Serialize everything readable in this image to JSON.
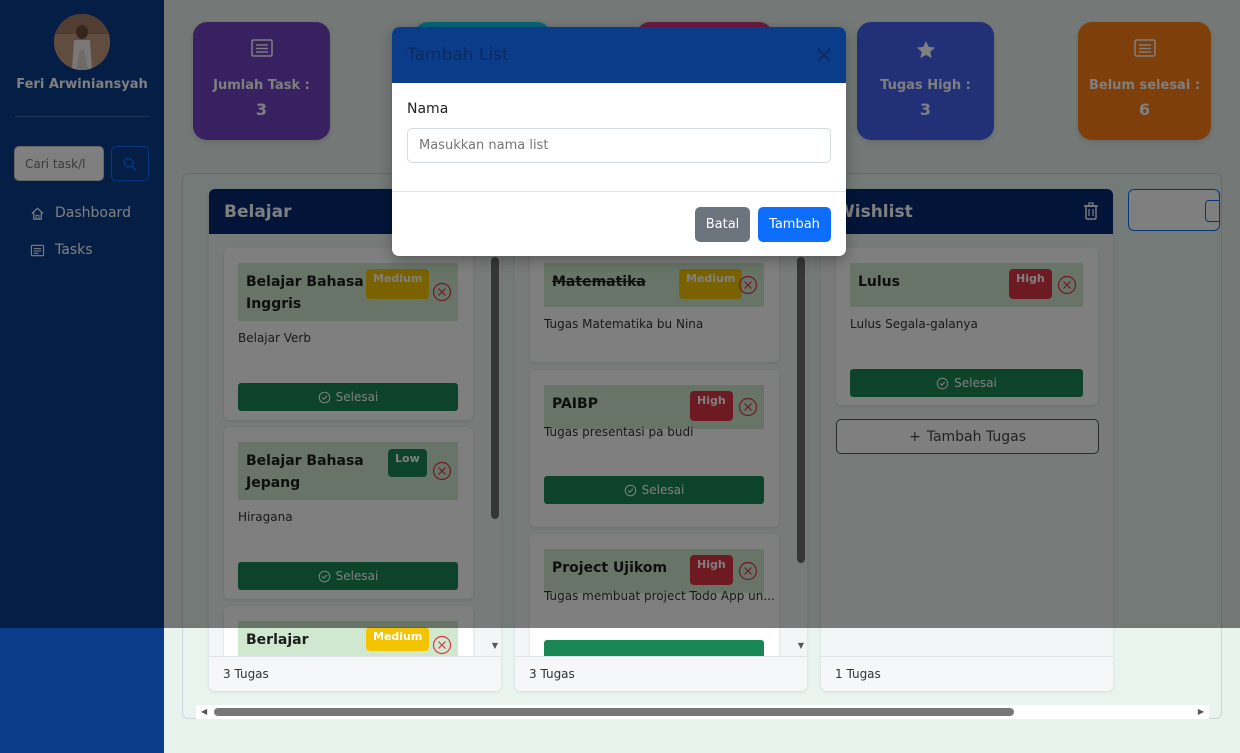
{
  "sidebar": {
    "username": "Feri Arwiniansyah",
    "search_placeholder": "Cari task/l",
    "nav": [
      {
        "label": "Dashboard",
        "icon": "home-icon"
      },
      {
        "label": "Tasks",
        "icon": "list-icon"
      }
    ]
  },
  "stats": [
    {
      "label": "Jumlah Task :",
      "value": "3",
      "color": "#6f42c1",
      "icon": "list-icon"
    },
    {
      "label": "",
      "value": "",
      "color": "#0dcaf0",
      "icon": ""
    },
    {
      "label": "",
      "value": "",
      "color": "#d63384",
      "icon": ""
    },
    {
      "label": "Tugas High :",
      "value": "3",
      "color": "#4361ee",
      "icon": "star-icon"
    },
    {
      "label": "Belum selesai :",
      "value": "6",
      "color": "#fd7e14",
      "icon": "list-icon"
    }
  ],
  "columns": [
    {
      "title": "Belajar",
      "footer": "3 Tugas",
      "tasks": [
        {
          "title": "Belajar Bahasa Inggris",
          "priority": "Medium",
          "desc": "Belajar Verb",
          "done_label": "Selesai"
        },
        {
          "title": "Belajar Bahasa Jepang",
          "priority": "Low",
          "desc": "Hiragana",
          "done_label": "Selesai"
        },
        {
          "title": "Berlajar",
          "priority": "Medium",
          "desc": "",
          "done_label": ""
        }
      ]
    },
    {
      "title": "",
      "footer": "3 Tugas",
      "tasks": [
        {
          "title": "Matematika",
          "priority": "Medium",
          "desc": "Tugas Matematika bu Nina",
          "done_label": ""
        },
        {
          "title": "PAIBP",
          "priority": "High",
          "desc": "Tugas presentasi pa budi",
          "done_label": "Selesai"
        },
        {
          "title": "Project Ujikom",
          "priority": "High",
          "desc": "Tugas membuat project Todo App un...",
          "done_label": ""
        }
      ]
    },
    {
      "title": "Wishlist",
      "footer": "1 Tugas",
      "tasks": [
        {
          "title": "Lulus",
          "priority": "High",
          "desc": "Lulus Segala-galanya",
          "done_label": "Selesai"
        }
      ],
      "add_task_label": "Tambah Tugas"
    }
  ],
  "modal": {
    "title": "Tambah List",
    "field_label": "Nama",
    "input_placeholder": "Masukkan nama list",
    "cancel_label": "Batal",
    "submit_label": "Tambah"
  }
}
